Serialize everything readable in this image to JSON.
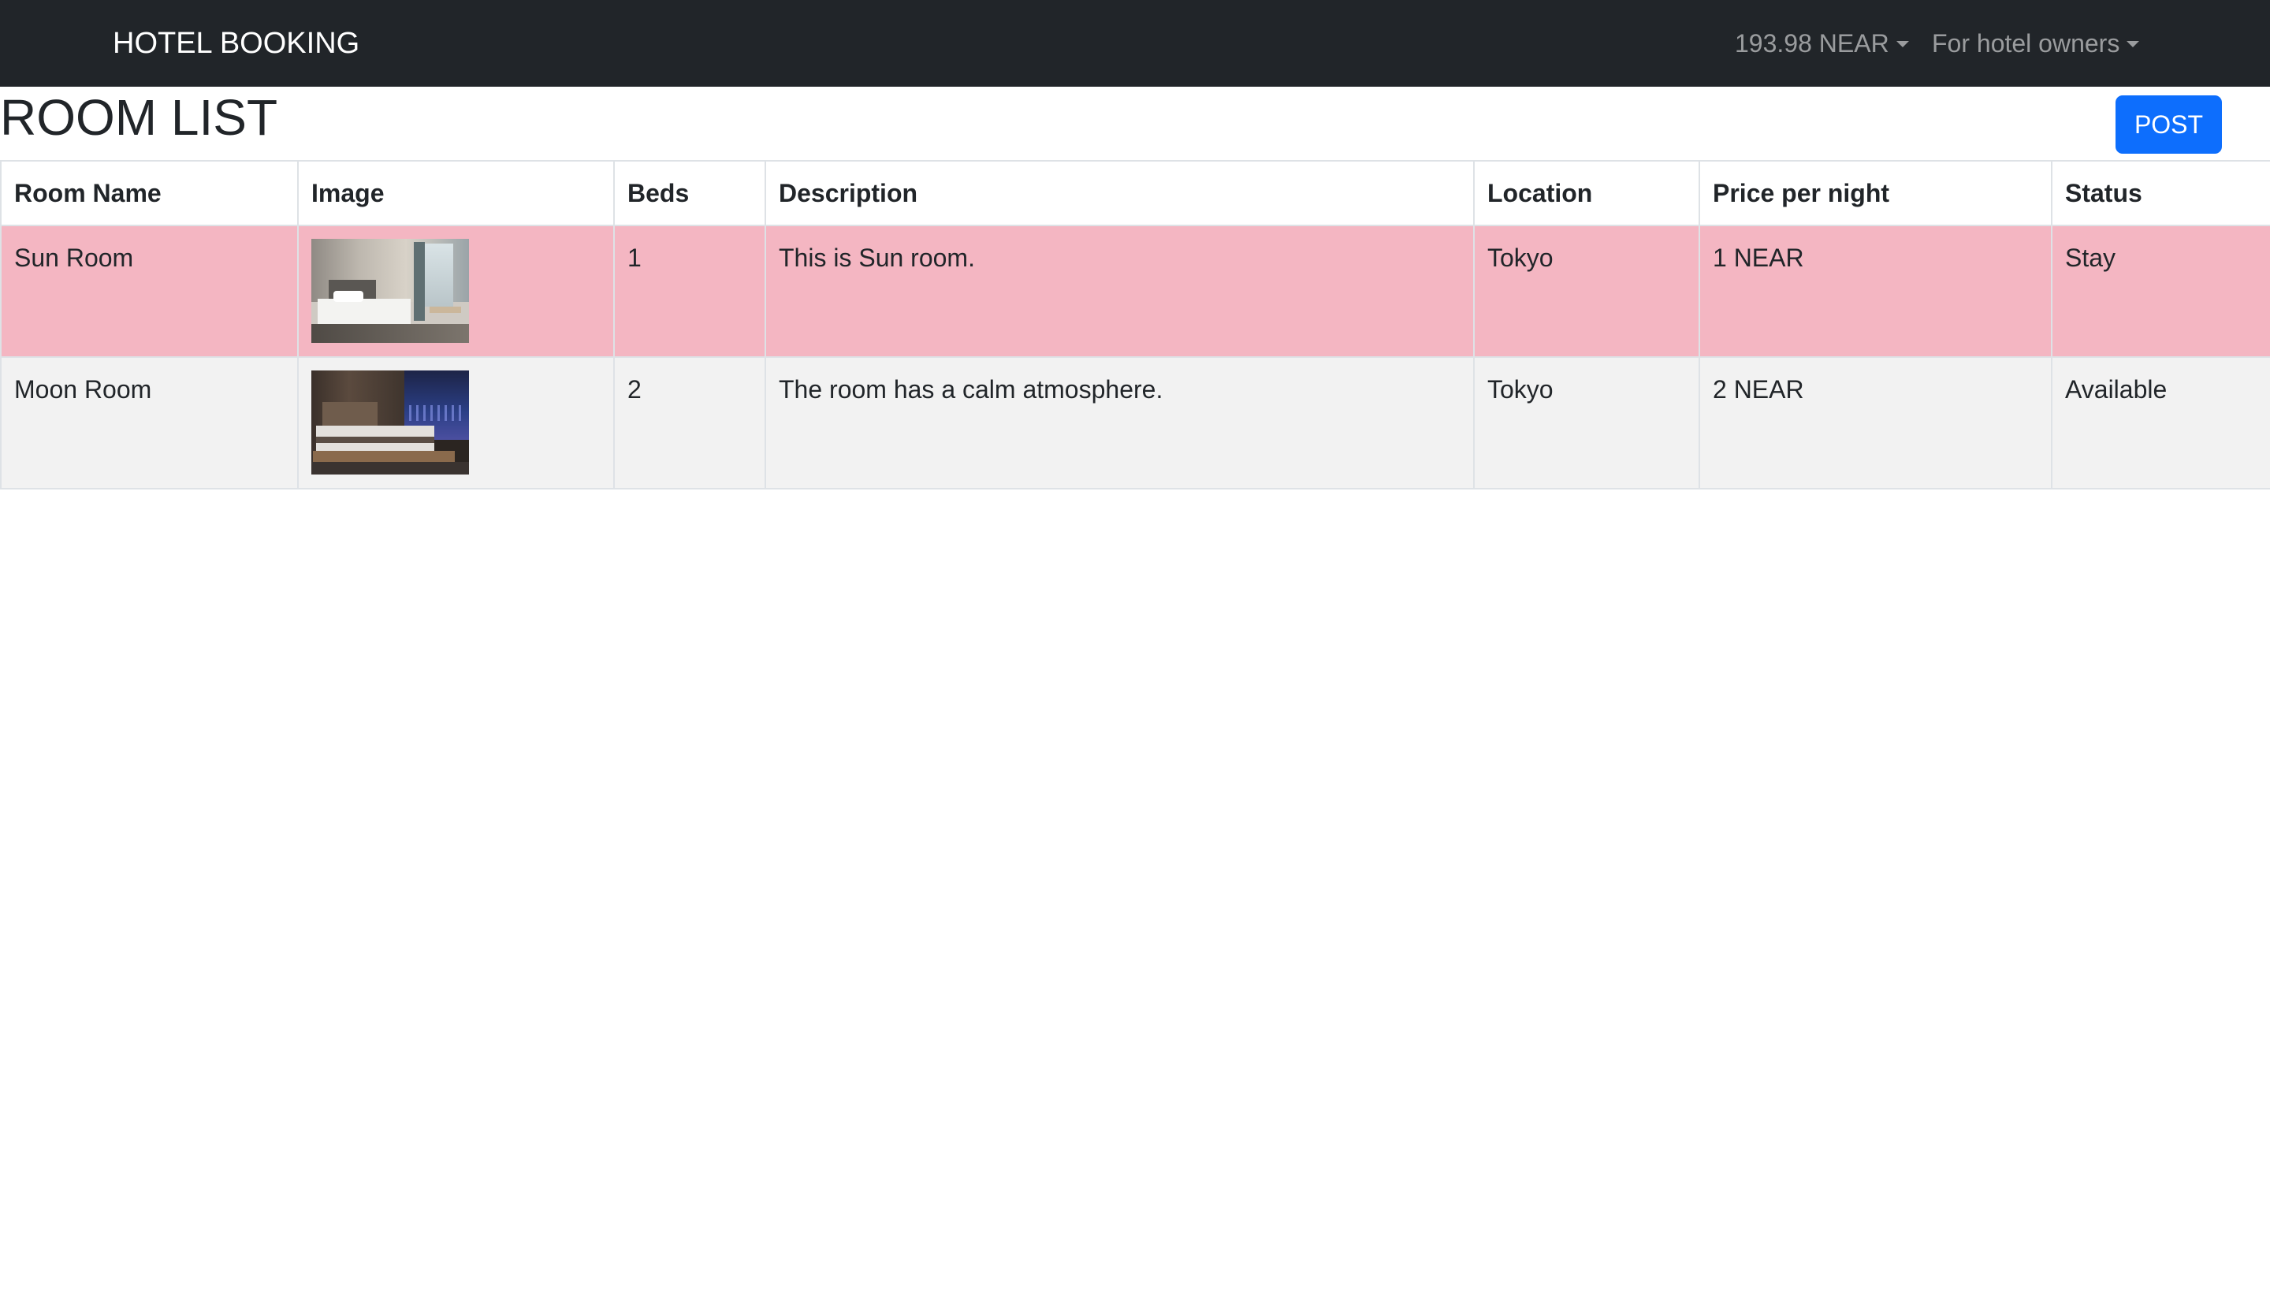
{
  "navbar": {
    "brand": "HOTEL BOOKING",
    "balance": "193.98 NEAR",
    "owners_menu": "For hotel owners"
  },
  "page": {
    "title": "ROOM LIST",
    "post_button": "POST"
  },
  "table": {
    "headers": [
      "Room Name",
      "Image",
      "Beds",
      "Description",
      "Location",
      "Price per night",
      "Status"
    ],
    "rows": [
      {
        "name": "Sun Room",
        "image": "hotel-room-photo",
        "beds": "1",
        "description": "This is Sun room.",
        "location": "Tokyo",
        "price": "1 NEAR",
        "status": "Stay",
        "row_color": "#f4b6c2"
      },
      {
        "name": "Moon Room",
        "image": "hotel-room-photo",
        "beds": "2",
        "description": "The room has a calm atmosphere.",
        "location": "Tokyo",
        "price": "2 NEAR",
        "status": "Available",
        "row_color": "#f2f2f2"
      }
    ]
  },
  "colors": {
    "navbar_bg": "#212529",
    "primary": "#0d6efd",
    "stay_row": "#f4b6c2"
  }
}
